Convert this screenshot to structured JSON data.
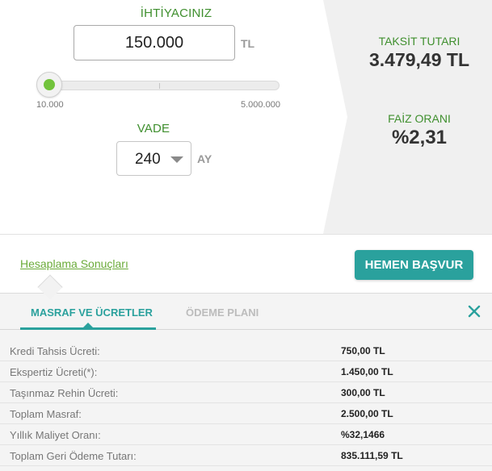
{
  "calculator": {
    "need_label": "İHTİYACINIZ",
    "amount_value": "150.000",
    "amount_unit": "TL",
    "slider": {
      "min_label": "10.000",
      "max_label": "5.000.000",
      "value": 150000,
      "min": 10000,
      "max": 5000000
    },
    "term_label": "VADE",
    "term_value": "240",
    "term_unit": "AY"
  },
  "results": {
    "installment_label": "TAKSİT TUTARI",
    "installment_value": "3.479,49 TL",
    "rate_label": "FAİZ ORANI",
    "rate_value": "%2,31"
  },
  "actions": {
    "results_link": "Hesaplama Sonuçları",
    "apply_button": "HEMEN BAŞVUR"
  },
  "details": {
    "tabs": [
      {
        "label": "MASRAF VE ÜCRETLER",
        "active": true
      },
      {
        "label": "ÖDEME PLANI",
        "active": false
      }
    ],
    "close_icon": "close-x-icon",
    "fees": [
      {
        "label": "Kredi Tahsis Ücreti:",
        "value": "750,00 TL"
      },
      {
        "label": "Ekspertiz Ücreti(*):",
        "value": "1.450,00 TL"
      },
      {
        "label": "Taşınmaz Rehin Ücreti:",
        "value": "300,00 TL"
      },
      {
        "label": "Toplam Masraf:",
        "value": "2.500,00 TL"
      },
      {
        "label": "Yıllık Maliyet Oranı:",
        "value": "%32,1466"
      },
      {
        "label": "Toplam Geri Ödeme Tutarı:",
        "value": "835.111,59 TL"
      }
    ]
  },
  "colors": {
    "accent_teal": "#2aa19d",
    "label_green": "#3f8f2e",
    "slider_green": "#72c33c",
    "panel_gray": "#f0f0f0"
  }
}
